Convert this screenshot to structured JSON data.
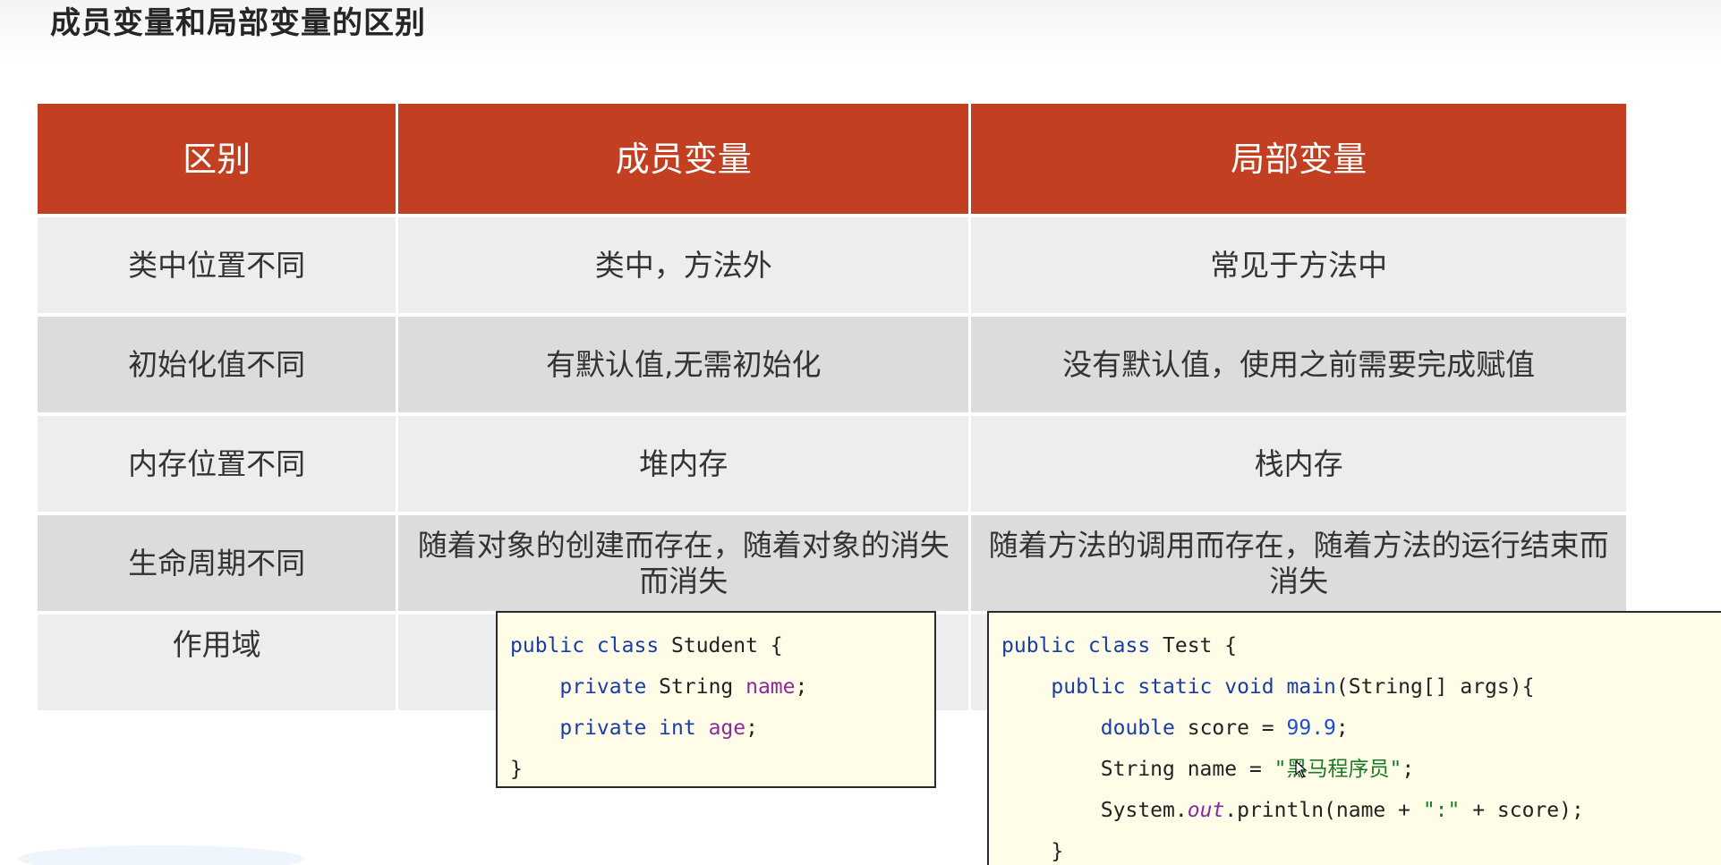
{
  "slide": {
    "title": "成员变量和局部变量的区别"
  },
  "table": {
    "headers": [
      "区别",
      "成员变量",
      "局部变量"
    ],
    "rows": [
      [
        "类中位置不同",
        "类中，方法外",
        "常见于方法中"
      ],
      [
        "初始化值不同",
        "有默认值,无需初始化",
        "没有默认值，使用之前需要完成赋值"
      ],
      [
        "内存位置不同",
        "堆内存",
        "栈内存"
      ],
      [
        "生命周期不同",
        "随着对象的创建而存在，随着对象的消失而消失",
        "随着方法的调用而存在，随着方法的运行结束而消失"
      ],
      [
        "作用域",
        "",
        ""
      ]
    ]
  },
  "code_student": {
    "line1": {
      "kw": "public class",
      "rest": " Student {"
    },
    "line2": {
      "indent": "    ",
      "kw": "private",
      "type": " String ",
      "field": "name",
      "end": ";"
    },
    "line3": {
      "indent": "    ",
      "kw": "private int",
      "sp": " ",
      "field": "age",
      "end": ";"
    },
    "line4": {
      "text": "}"
    }
  },
  "code_test": {
    "line1": {
      "kw": "public class",
      "rest": " Test {"
    },
    "line2": {
      "indent": "    ",
      "kw": "public static void",
      "sp": " ",
      "method": "main",
      "rest": "(String[] args){"
    },
    "line3": {
      "indent": "        ",
      "kw": "double",
      "rest": " score = ",
      "num": "99.9",
      "end": ";"
    },
    "line4": {
      "indent": "        ",
      "rest": "String name = ",
      "str": "\"黑马程序员\"",
      "end": ";"
    },
    "line5": {
      "indent": "        ",
      "pre": "System.",
      "static": "out",
      "mid": ".println(name + ",
      "str": "\":\"",
      "end": " + score);"
    },
    "line6": {
      "indent": "    ",
      "text": "}"
    }
  },
  "colors": {
    "header": "#c33f21",
    "row_light": "#ededed",
    "row_dark": "#dcdcdc",
    "code_bg": "#fffde8",
    "keyword": "#1a3ca8",
    "field": "#8a2a9c",
    "string": "#1c7a2a"
  }
}
